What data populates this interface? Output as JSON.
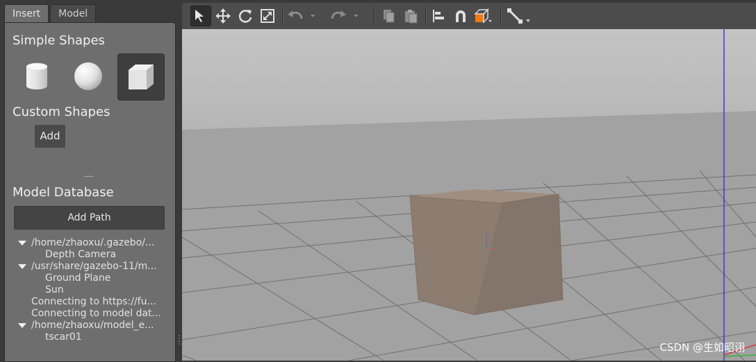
{
  "tabs": [
    {
      "label": "Insert",
      "active": true
    },
    {
      "label": "Model",
      "active": false
    }
  ],
  "simple_shapes": {
    "title": "Simple Shapes",
    "items": [
      {
        "icon": "cylinder-icon",
        "selected": false
      },
      {
        "icon": "sphere-icon",
        "selected": false
      },
      {
        "icon": "box-icon",
        "selected": true
      }
    ]
  },
  "custom_shapes": {
    "title": "Custom Shapes",
    "add_label": "Add"
  },
  "splitter": {
    "label": "......"
  },
  "model_database": {
    "title": "Model Database",
    "add_path_label": "Add Path",
    "tree": [
      {
        "text": "/home/zhaoxu/.gazebo/...",
        "level": 0,
        "expanded": true
      },
      {
        "text": "Depth Camera",
        "level": 1
      },
      {
        "text": "/usr/share/gazebo-11/m...",
        "level": 0,
        "expanded": true
      },
      {
        "text": "Ground Plane",
        "level": 1
      },
      {
        "text": "Sun",
        "level": 1
      },
      {
        "text": "Connecting to https://fu...",
        "level": 0
      },
      {
        "text": "Connecting to model dat...",
        "level": 0
      },
      {
        "text": "/home/zhaoxu/model_e...",
        "level": 0,
        "expanded": true
      },
      {
        "text": "tscar01",
        "level": 1
      }
    ]
  },
  "toolbar": {
    "tools": [
      "select-mode-icon",
      "translate-mode-icon",
      "rotate-mode-icon",
      "scale-mode-icon",
      "undo-icon",
      "redo-icon",
      "copy-icon",
      "paste-icon",
      "align-icon",
      "snap-icon",
      "view-angle-icon",
      "joint-icon"
    ],
    "selected": "select-mode-icon"
  },
  "scene": {
    "sky_color": "#bdbdbd",
    "ground_color": "#9f9f9f",
    "grid_color": "#6f6f6f",
    "box_color": "#8d7d70",
    "z_axis_color": "#3a3ad8"
  },
  "watermark": "CSDN @生如昭诩"
}
